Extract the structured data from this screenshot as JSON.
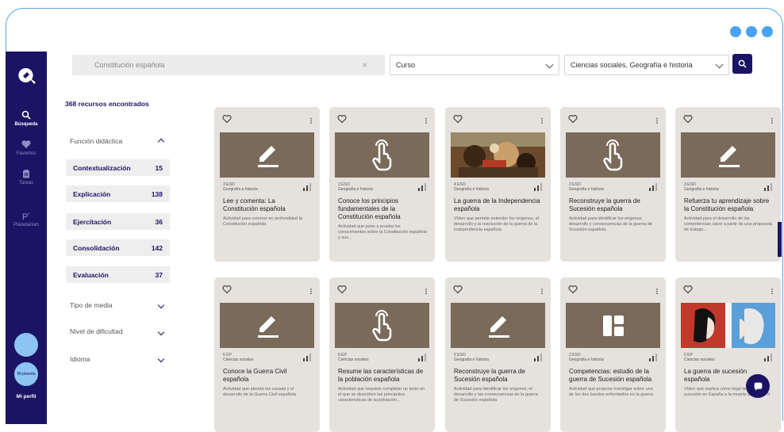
{
  "sidebar": {
    "nav": [
      {
        "label": "Búsqueda",
        "icon": "search-icon",
        "active": true
      },
      {
        "label": "Favoritos",
        "icon": "heart-icon",
        "active": false
      },
      {
        "label": "Tareas",
        "icon": "clipboard-icon",
        "active": false
      },
      {
        "label": "Planetarium",
        "icon": "planetarium-icon",
        "active": false
      }
    ],
    "avatar_label": "Mi planeta",
    "profile_label": "Mi perfil"
  },
  "search": {
    "value": "Constitución española"
  },
  "course_select": {
    "value": "Curso"
  },
  "subject_select": {
    "value": "Ciencias sociales, Geografía e historia"
  },
  "results": {
    "count_text": "368 recursos encontrados"
  },
  "filters": {
    "didactic": {
      "title": "Función didáctica",
      "items": [
        {
          "label": "Contextualización",
          "count": "15"
        },
        {
          "label": "Explicación",
          "count": "138"
        },
        {
          "label": "Ejercitación",
          "count": "36"
        },
        {
          "label": "Consolidación",
          "count": "142"
        },
        {
          "label": "Evaluación",
          "count": "37"
        }
      ]
    },
    "media": {
      "title": "Tipo de media"
    },
    "difficulty": {
      "title": "Nivel de dificultad"
    },
    "language": {
      "title": "Idioma"
    }
  },
  "cards": [
    {
      "level": "3 ESO",
      "subject": "Geografía e historia",
      "title": "Lee y comenta: La Constitución española",
      "desc": "Actividad para conocer en profundidad la Constitución española",
      "thumb": "pencil"
    },
    {
      "level": "3 ESO",
      "subject": "Geografía e historia",
      "title": "Conoce los principios fundamentales de la Constitución española",
      "desc": "Actividad que pone a prueba los conocimientos sobre la Constitución española y sus...",
      "thumb": "hand"
    },
    {
      "level": "4 ESO",
      "subject": "Geografía e historia",
      "title": "La guerra de la Independencia española",
      "desc": "Vídeo que permite entender los orígenes, el desarrollo y la resolución de la guerra de la Independencia española",
      "thumb": "painting"
    },
    {
      "level": "2 ESO",
      "subject": "Geografía e historia",
      "title": "Reconstruye la guerra de Sucesión española",
      "desc": "Actividad para identificar los orígenes, desarrollo y consecuencias de la guerra de Sucesión española",
      "thumb": "hand"
    },
    {
      "level": "3 ESO",
      "subject": "Geografía e historia",
      "title": "Refuerza tu aprendizaje sobre la Constitución española",
      "desc": "Actividad para el desarrollo de las competencias clave a partir de una propuesta de trabajo...",
      "thumb": "pencil"
    },
    {
      "level": "6 EP",
      "subject": "Ciencias sociales",
      "title": "Conoce la Guerra Civil española",
      "desc": "Actividad que aborda las causas y el desarrollo de la Guerra Civil española",
      "thumb": "pencil"
    },
    {
      "level": "5 EP",
      "subject": "Ciencias sociales",
      "title": "Resume las características de la población española",
      "desc": "Actividad que requiere completar un texto en el que se describen las principales características de la población...",
      "thumb": "hand"
    },
    {
      "level": "2 ESO",
      "subject": "Geografía e historia",
      "title": "Reconstruye la guerra de Sucesión española",
      "desc": "Actividad para identificar los orígenes, el desarrollo y las consecuencias de la guerra de Sucesión española",
      "thumb": "pencil"
    },
    {
      "level": "2 ESO",
      "subject": "Geografía e historia",
      "title": "Competencias: estudio de la guerra de Sucesión española",
      "desc": "Actividad que propone investigar sobre uno de los dos bandos enfrentados en la guerra",
      "thumb": "layout"
    },
    {
      "level": "5 EP",
      "subject": "Ciencias sociales",
      "title": "La guerra de sucesión española",
      "desc": "Vídeo que explica cómo llegó la guerra de sucesión en España a la muerte de Carlos II",
      "thumb": "portraits"
    }
  ],
  "colors": {
    "brand": "#1b1464",
    "accent": "#4aa3f0",
    "card_bg": "#e5e1dd",
    "thumb_bg": "#7a6a5a"
  }
}
